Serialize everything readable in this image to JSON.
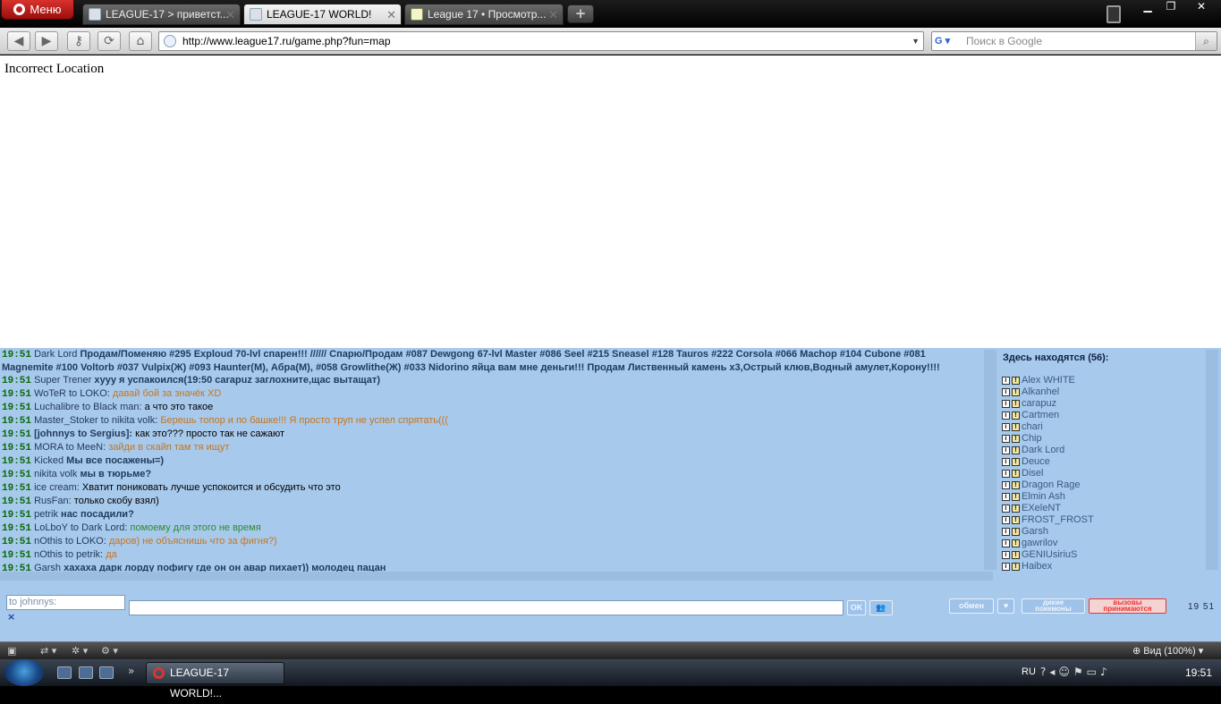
{
  "browser": {
    "menu_label": "Меню",
    "tabs": [
      {
        "label": "LEAGUE-17 > приветст..."
      },
      {
        "label": "LEAGUE-17 WORLD!"
      },
      {
        "label": "League 17 • Просмотр..."
      }
    ],
    "url": "http://www.league17.ru/game.php?fun=map",
    "search_placeholder": "Поиск в Google"
  },
  "page": {
    "message": "Incorrect Location"
  },
  "chat": {
    "messages": [
      {
        "time": "19:51",
        "from": "Dark Lord",
        "text": "Продам/Поменяю #295 Exploud 70-lvl спарен!!! ////// Спарю/Продам #087 Dewgong 67-lvl Master #086 Seel #215 Sneasel #128 Tauros #222 Corsola #066 Machop #104 Cubone #081 Magnemite #100 Voltorb #037 Vulpix(Ж) #093 Haunter(М), Абра(М), #058 Growlithe(Ж) #033 Nidorino яйца вам мне деньги!!! Продам Лиственный камень х3,Острый клюв,Водный амулет,Корону!!!!",
        "style": "bold"
      },
      {
        "time": "19:51",
        "from": "Super Trener",
        "text": "хуyy я успакоился(19:50 carapuz заглохните,щас вытащат)",
        "style": "bold"
      },
      {
        "time": "19:51",
        "from": "WoTeR to LOKO:",
        "text": "давай бой за значёк XD",
        "style": "orange"
      },
      {
        "time": "19:51",
        "from": "Luchalibre to Black man:",
        "text": "а что это такое",
        "style": "norm"
      },
      {
        "time": "19:51",
        "from": "Master_Stoker to nikita volk:",
        "text": "Берешь топор и по башке!!! Я просто труп не успел спрятать(((",
        "style": "orange"
      },
      {
        "time": "19:51",
        "from": "[johnnys to Sergius]:",
        "text": "как это??? просто так не сажают",
        "style": "norm",
        "from_bold": true
      },
      {
        "time": "19:51",
        "from": "MORA to MeeN:",
        "text": "зайди в скайп там тя ищут",
        "style": "orange"
      },
      {
        "time": "19:51",
        "from": "Kicked",
        "text": "Мы все посажены=)",
        "style": "bold"
      },
      {
        "time": "19:51",
        "from": "nikita volk",
        "text": "мы в тюрьме?",
        "style": "bold"
      },
      {
        "time": "19:51",
        "from": "ice cream:",
        "text": "Хватит поникoвать лучше успокоится и обсудить что это",
        "style": "norm"
      },
      {
        "time": "19:51",
        "from": "RusFan:",
        "text": "только скобу взял)",
        "style": "norm"
      },
      {
        "time": "19:51",
        "from": "petrik",
        "text": "нас посадили?",
        "style": "bold"
      },
      {
        "time": "19:51",
        "from": "LoLboY to Dark Lord:",
        "text": "помоему для этого не время",
        "style": "green"
      },
      {
        "time": "19:51",
        "from": "nOthis to LOKO:",
        "text": "даров) не объяснишь что за фигня?)",
        "style": "orange"
      },
      {
        "time": "19:51",
        "from": "nOthis to petrik:",
        "text": "да",
        "style": "orange"
      },
      {
        "time": "19:51",
        "from": "Garsh",
        "text": "хахаха дарк лорду пофигу где он он авар пихает)) молодец пацан",
        "style": "bold"
      }
    ],
    "online_title": "Здесь находятся (56):",
    "online_users": [
      "Alex WHITE",
      "Alkanhel",
      "carapuz",
      "Cartmen",
      "chari",
      "Chip",
      "Dark Lord",
      "Deuce",
      "Disel",
      "Dragon Rage",
      "Elmin Ash",
      "EXeleNT",
      "FROST_FROST",
      "Garsh",
      "gawrilov",
      "GENIUsiriuS",
      "Haibex"
    ],
    "to_placeholder": "to johnnys:",
    "clear_label": "×",
    "ok_label": "OK",
    "obmen_label": "обмен",
    "wild_label_1": "дикие",
    "wild_label_2": "покемоны",
    "calls_label_1": "вызовы",
    "calls_label_2": "принимаются",
    "clock": "19  51"
  },
  "statusbar": {
    "zoom": "Вид (100%)"
  },
  "taskbar": {
    "task_label": "LEAGUE-17 WORLD!...",
    "lang": "RU",
    "time": "19:51"
  }
}
